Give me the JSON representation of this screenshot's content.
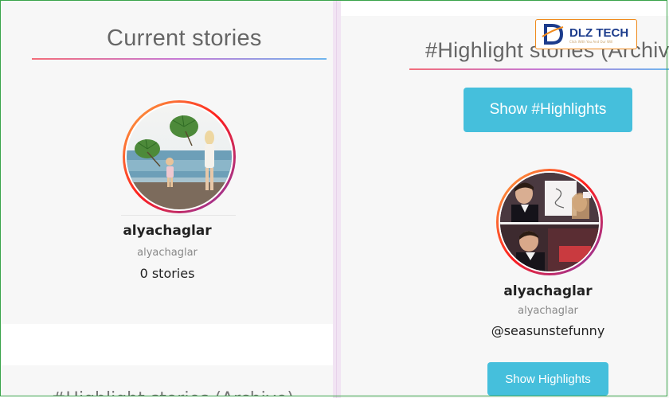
{
  "left": {
    "title": "Current stories",
    "profile": {
      "name": "alyachaglar",
      "handle": "alyachaglar",
      "stories": "0 stories"
    },
    "cut_title": "#Highlight stories (Archive)"
  },
  "right": {
    "title": "#Highlight stories (Archive)",
    "show_highlights_button": "Show #Highlights",
    "profile": {
      "name": "alyachaglar",
      "handle": "alyachaglar",
      "highlight_name": "@seasunstefunny"
    },
    "show_button": "Show Highlights"
  },
  "watermark": {
    "brand": "DLZ TECH",
    "tagline": "Click With You And Our Will"
  },
  "colors": {
    "button": "#45bfdc",
    "gradient_start": "#f36d7a",
    "gradient_end": "#6fb6ee",
    "avatar_ring": "#fd1d1d"
  }
}
